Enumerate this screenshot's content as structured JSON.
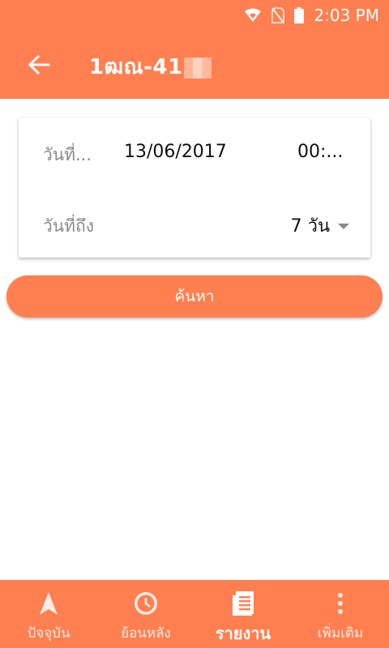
{
  "status_bar": {
    "time": "2:03 PM",
    "icons": [
      "wifi-icon",
      "no-sim-icon",
      "battery-icon"
    ]
  },
  "app_bar": {
    "title": "1ฒณ-41"
  },
  "filter_card": {
    "date_label": "วันที่...",
    "date_value": "13/06/2017",
    "time_value": "00:...",
    "to_label": "วันที่ถึง",
    "days_value": "7 วัน"
  },
  "search_button": {
    "label": "ค้นหา"
  },
  "bottom_nav": {
    "items": [
      {
        "label": "ปัจจุบัน",
        "icon": "navigation-arrow-icon"
      },
      {
        "label": "ย้อนหลัง",
        "icon": "clock-icon"
      },
      {
        "label": "รายงาน",
        "icon": "report-icon",
        "active": true
      },
      {
        "label": "เพิ่มเติม",
        "icon": "more-vertical-icon"
      }
    ]
  },
  "colors": {
    "primary": "#ff7f50",
    "text_muted": "#8a8a8a",
    "text_dark": "#111111"
  }
}
